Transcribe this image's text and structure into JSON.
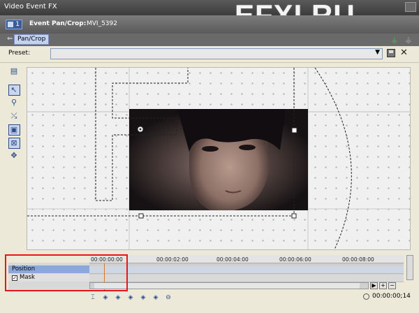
{
  "window": {
    "title": "Video Event FX",
    "watermark": "EFXI.RU"
  },
  "header": {
    "fx_count": "1",
    "event_label": "Event Pan/Crop:",
    "clip_name": "MVI_5392"
  },
  "tab": {
    "label": "Pan/Crop"
  },
  "preset": {
    "label": "Preset:",
    "value": ""
  },
  "timeline": {
    "ticks": [
      "00:00:00:00",
      "00:00:02:00",
      "00:00:04:00",
      "00:00:06:00",
      "00:00:08:00"
    ],
    "tracks": [
      {
        "label": "Position"
      },
      {
        "label": "Mask",
        "checked": true
      }
    ],
    "current_time": "00:00:00;14"
  },
  "colors": {
    "accent": "#2c4a8a",
    "highlight": "#e8161b",
    "selected_track": "#8ca8d8"
  }
}
